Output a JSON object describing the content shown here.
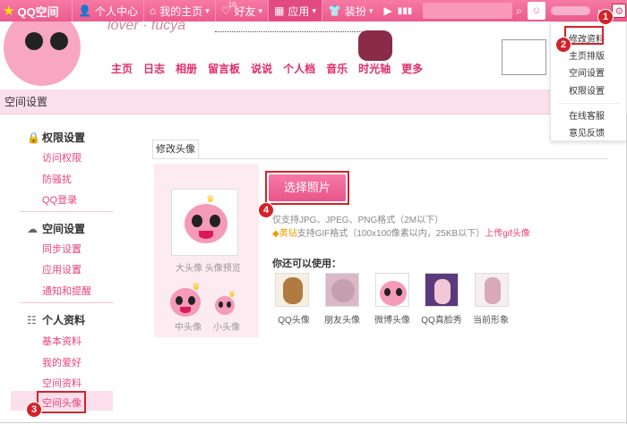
{
  "app": {
    "logo": "QQ空间"
  },
  "topnav": {
    "items": [
      {
        "label": "个人中心",
        "icon": "person-icon"
      },
      {
        "label": "我的主页",
        "icon": "home-icon",
        "suffix": "▾"
      },
      {
        "label": "好友",
        "icon": "friends-icon",
        "badge": "10",
        "suffix": "▾"
      },
      {
        "label": "应用",
        "icon": "apps-icon",
        "suffix": "▾"
      },
      {
        "label": "装扮",
        "icon": "shirt-icon",
        "suffix": "▾"
      }
    ]
  },
  "banner": {
    "script": "lover · fucya",
    "menu": [
      "主页",
      "日志",
      "相册",
      "留言板",
      "说说",
      "个人档",
      "音乐",
      "时光轴",
      "更多"
    ]
  },
  "section": {
    "title": "空间设置"
  },
  "sidebar": {
    "groups": [
      {
        "title": "权限设置",
        "icon": "lock-icon",
        "links": [
          "访问权限",
          "防骚扰",
          "QQ登录"
        ]
      },
      {
        "title": "空间设置",
        "icon": "cloud-icon",
        "links": [
          "同步设置",
          "应用设置",
          "通知和提醒"
        ]
      },
      {
        "title": "个人资料",
        "icon": "user-card-icon",
        "links": [
          "基本资料",
          "我的爱好",
          "空间资料",
          "空间头像"
        ]
      }
    ]
  },
  "tab": {
    "label": "修改头像"
  },
  "preview": {
    "big_caption": "大头像 头像预览",
    "mid_caption": "中头像",
    "small_caption": "小头像"
  },
  "upload": {
    "button": "选择照片",
    "info1": "仅支持JPG、JPEG、PNG格式（2M以下）",
    "vip": "黄钻",
    "info2": "支持GIF格式（100x100像素以内，25KB以下）",
    "gif_link": "上传gif头像"
  },
  "options": {
    "title": "你还可以使用：",
    "items": [
      "QQ头像",
      "朋友头像",
      "微博头像",
      "QQ真脸秀",
      "当前形象"
    ]
  },
  "dropdown": {
    "items": [
      "修改资料",
      "主页排版",
      "空间设置",
      "权限设置",
      "在线客服",
      "意见反馈"
    ]
  },
  "annotations": [
    "1",
    "2",
    "3",
    "4"
  ],
  "colors": {
    "accent": "#f46a9a",
    "highlight": "#d2232a",
    "link": "#e8447c"
  }
}
